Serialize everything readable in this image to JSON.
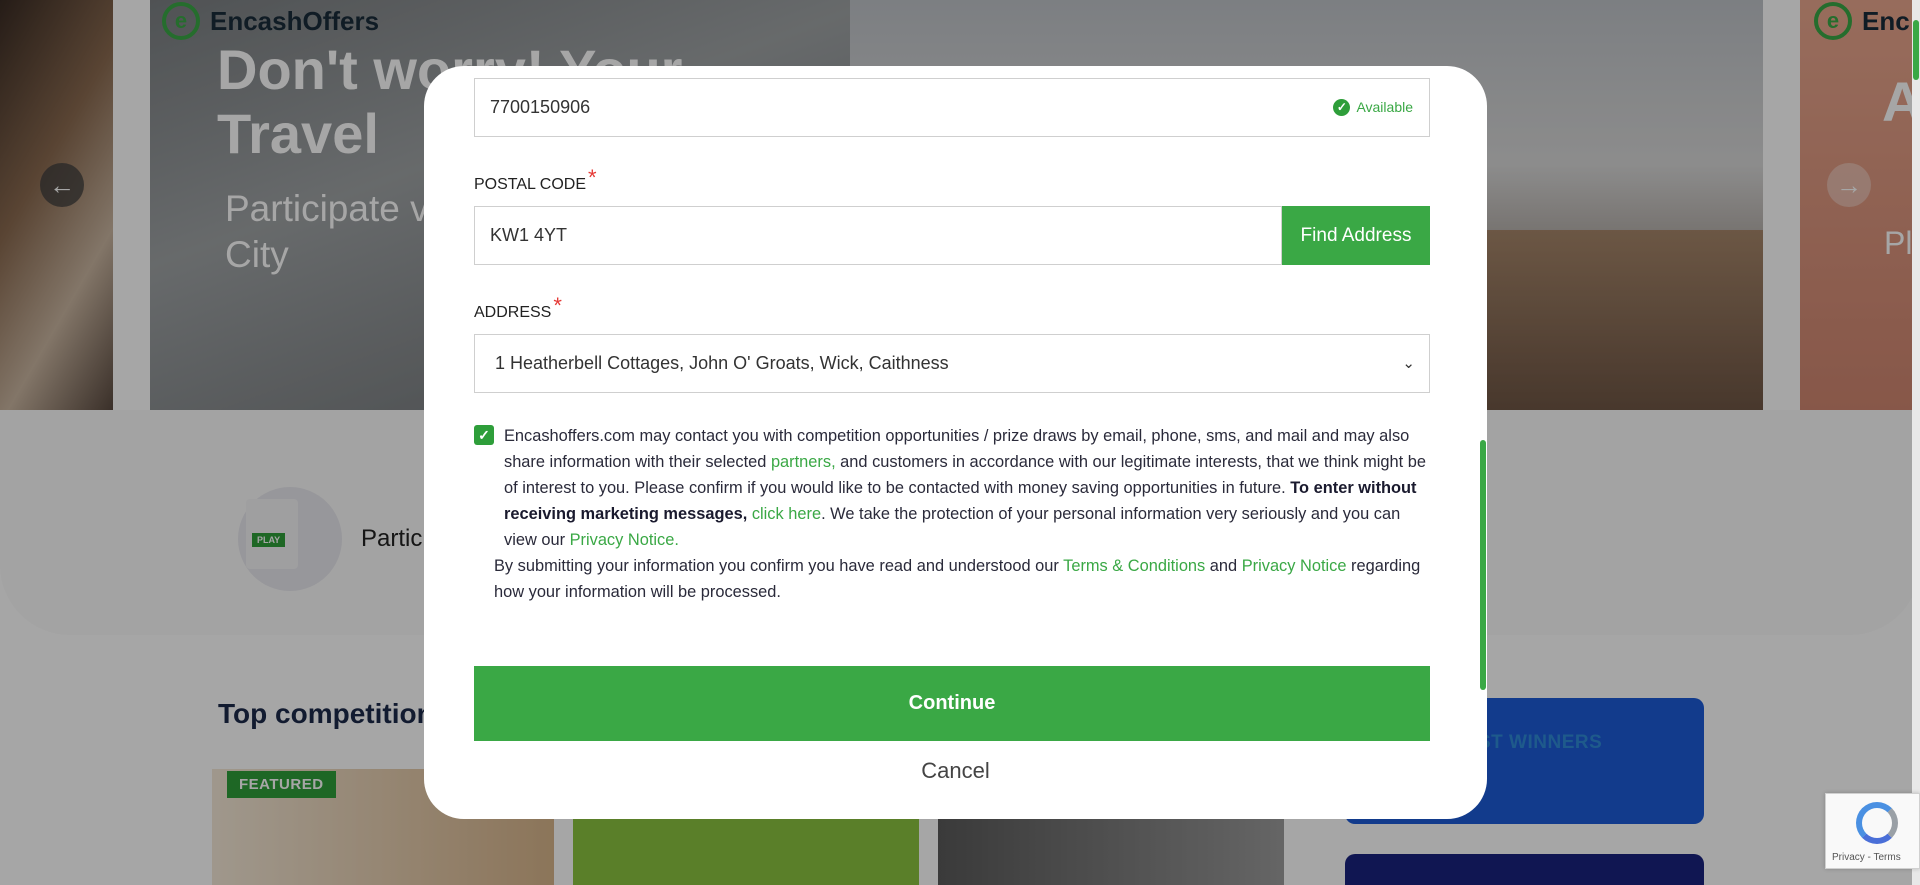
{
  "background": {
    "slide_left": {
      "brand": "",
      "headline": "",
      "sub": ""
    },
    "slide_main": {
      "brand": "EncashOffers",
      "headline": "Don't worry! Your Travel",
      "sub": "Participate voucher wo Vatican City"
    },
    "slide_right": {
      "brand": "Enc",
      "headline": "A A",
      "sub": "Pl W"
    },
    "play_tag": "PLAY",
    "participate_text": "Partic",
    "top_competitions": "Top competition",
    "featured_badge": "FEATURED",
    "winners_text": "ST WINNERS"
  },
  "modal": {
    "phone": {
      "value": "7700150906",
      "status": "Available"
    },
    "postal": {
      "label": "POSTAL CODE",
      "required_mark": "*",
      "value": "KW1 4YT",
      "button": "Find Address"
    },
    "address": {
      "label": "ADDRESS",
      "required_mark": "*",
      "selected": "1 Heatherbell Cottages, John O' Groats, Wick, Caithness"
    },
    "consent": {
      "checked": true,
      "part1": "Encashoffers.com may contact you with competition opportunities / prize draws by email, phone, sms, and mail and may also share information with their selected ",
      "partners_link": "partners,",
      "part2": " and customers in accordance with our legitimate interests, that we think might be of interest to you. Please confirm if you would like to be contacted with money saving opportunities in future. ",
      "bold": "To enter without receiving marketing messages,",
      "click_here_link": "click here",
      "part3": ". We take the protection of your personal information very seriously and you can view our ",
      "privacy_link": "Privacy Notice."
    },
    "terms": {
      "part1": "By submitting your information you confirm you have read and understood our ",
      "terms_link": "Terms & Conditions",
      "and": " and ",
      "privacy_link": "Privacy Notice",
      "part2": " regarding how your information will be processed."
    },
    "continue_button": "Continue",
    "cancel_button": "Cancel"
  },
  "recaptcha": {
    "links": "Privacy - Terms"
  },
  "colors": {
    "accent": "#3aa845",
    "required": "#e53935",
    "link": "#3aa845"
  }
}
